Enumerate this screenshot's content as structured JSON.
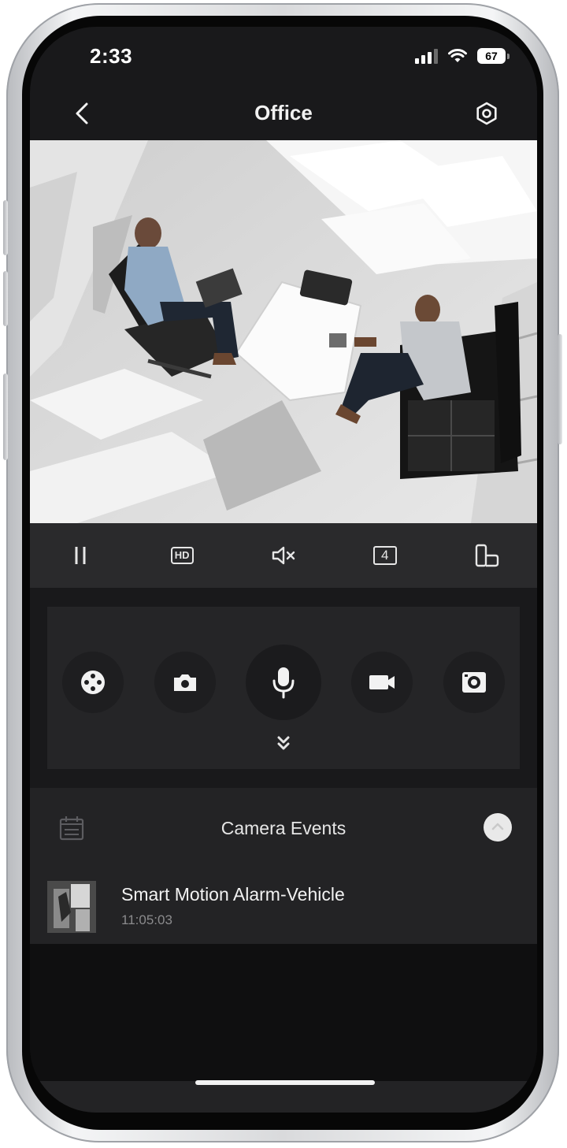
{
  "status_bar": {
    "time": "2:33",
    "battery": "67"
  },
  "nav": {
    "title": "Office"
  },
  "video": {
    "toolbar": {
      "hd_label": "HD",
      "window_count": "4"
    }
  },
  "controls": {
    "buttons": [
      "ptz-icon",
      "snapshot-icon",
      "microphone-icon",
      "record-icon",
      "fisheye-icon"
    ]
  },
  "events": {
    "title": "Camera Events",
    "items": [
      {
        "title": "Smart Motion Alarm-Vehicle",
        "time": "11:05:03"
      }
    ]
  },
  "colors": {
    "background": "#19191b",
    "toolbar": "#2a2a2c",
    "panel": "#252527",
    "text": "#f2f2f2"
  }
}
